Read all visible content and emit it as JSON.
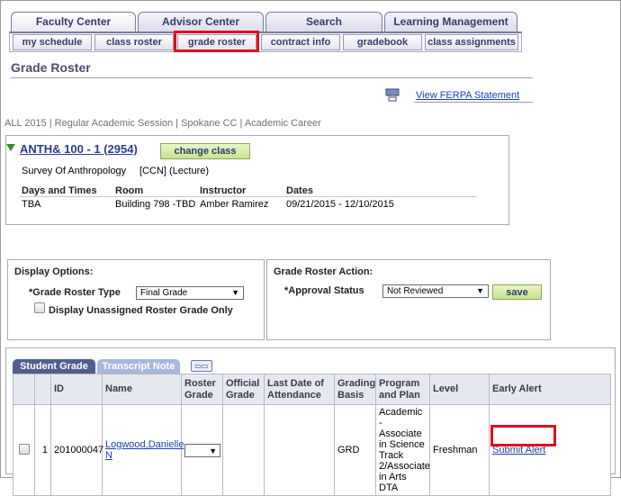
{
  "tabs": [
    "Faculty Center",
    "Advisor Center",
    "Search",
    "Learning Management"
  ],
  "subtabs": [
    "my schedule",
    "class roster",
    "grade roster",
    "contract info",
    "gradebook",
    "class assignments"
  ],
  "page_title": "Grade Roster",
  "ferpa_link": "View FERPA Statement",
  "term_line": "ALL 2015 | Regular Academic Session | Spokane CC | Academic Career",
  "class_info": {
    "title": "ANTH& 100 - 1 (2954)",
    "change_button": "change class",
    "description": "Survey Of Anthropology",
    "type": "[CCN] (Lecture)",
    "headers": [
      "Days and Times",
      "Room",
      "Instructor",
      "Dates"
    ],
    "values": [
      "TBA",
      "Building 798 -TBD",
      "Amber Ramirez",
      "09/21/2015 - 12/10/2015"
    ]
  },
  "display_options": {
    "title": "Display Options:",
    "roster_type_label": "*Grade Roster Type",
    "roster_type_value": "Final Grade",
    "unassigned_label": "Display Unassigned Roster Grade Only"
  },
  "grade_action": {
    "title": "Grade Roster Action:",
    "approval_label": "*Approval Status",
    "approval_value": "Not Reviewed",
    "save_button": "save"
  },
  "grid": {
    "tab_student": "Student Grade",
    "tab_transcript": "Transcript Note",
    "columns": [
      "",
      "",
      "ID",
      "Name",
      "Roster Grade",
      "Official Grade",
      "Last Date of Attendance",
      "Grading Basis",
      "Program and Plan",
      "Level",
      "Early Alert"
    ],
    "row": {
      "num": "1",
      "id": "201000047",
      "name": "Logwood,Danielle N",
      "roster_grade": "",
      "official_grade": "",
      "last_attendance": "",
      "grading_basis": "GRD",
      "program": "Academic - Associate in Science Track 2/Associate in Arts DTA",
      "level": "Freshman",
      "early_alert": "Submit Alert"
    }
  },
  "colors": {
    "highlight": "#e0101a",
    "tab_text": "#3a3a6a",
    "link": "#1a3fb4"
  }
}
